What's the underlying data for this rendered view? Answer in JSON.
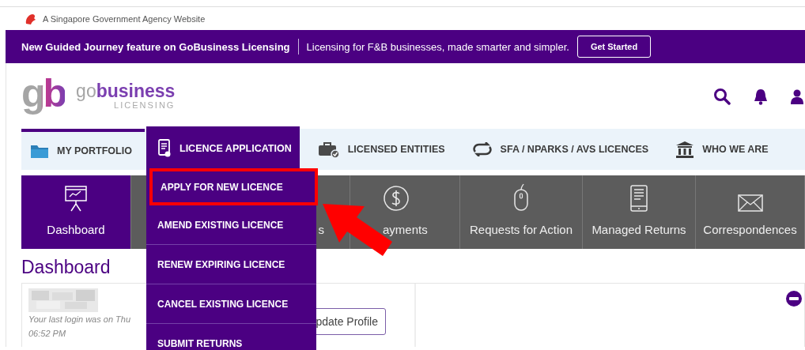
{
  "gov_bar": {
    "text": "A Singapore Government Agency Website"
  },
  "banner": {
    "headline": "New Guided Journey feature on GoBusiness Licensing",
    "message": "Licensing for F&B businesses, made smarter and simpler.",
    "button": "Get Started"
  },
  "logo": {
    "mark": "gb",
    "name": "go**business**",
    "tagline": "LICENSING"
  },
  "nav": [
    {
      "label": "MY PORTFOLIO",
      "selected": false,
      "top_bar": true
    },
    {
      "label": "LICENCE APPLICATION",
      "selected": true,
      "top_bar": false
    },
    {
      "label": "LICENSED ENTITIES",
      "selected": false,
      "top_bar": false
    },
    {
      "label": "SFA / NPARKS / AVS LICENCES",
      "selected": false,
      "top_bar": false
    },
    {
      "label": "WHO WE ARE",
      "selected": false,
      "top_bar": false
    }
  ],
  "menu": {
    "items": [
      {
        "label": "APPLY FOR NEW LICENCE",
        "highlighted": true
      },
      {
        "label": "AMEND EXISTING LICENCE",
        "highlighted": false
      },
      {
        "label": "RENEW EXPIRING LICENCE",
        "highlighted": false
      },
      {
        "label": "CANCEL EXISTING LICENCE",
        "highlighted": false
      },
      {
        "label": "SUBMIT RETURNS",
        "highlighted": false
      }
    ]
  },
  "tiles": [
    {
      "label": "Dashboard",
      "selected": true
    },
    {
      "label": "s",
      "selected": false
    },
    {
      "label": "ayments",
      "selected": false
    },
    {
      "label": "Requests for Action",
      "selected": false
    },
    {
      "label": "Managed Returns",
      "selected": false
    },
    {
      "label": "Correspondences",
      "selected": false
    }
  ],
  "page_title": "Dashboard",
  "profile": {
    "last_login": "Your last login was on Thu",
    "last_login_time": "06:52 PM",
    "button": "pdate Profile"
  }
}
